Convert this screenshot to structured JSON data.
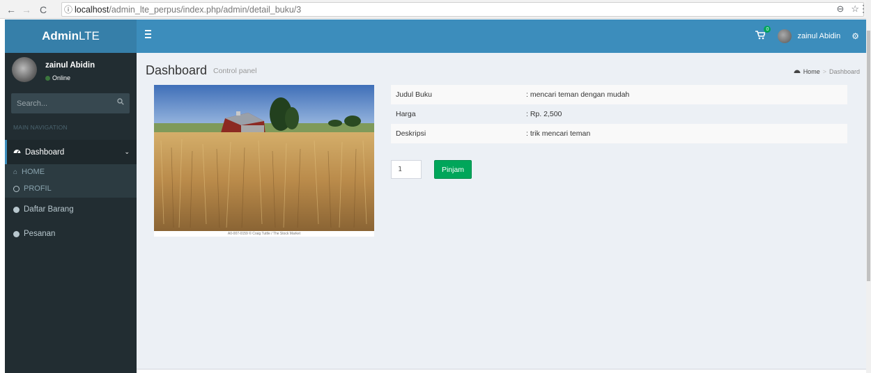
{
  "browser": {
    "url_host": "localhost",
    "url_path": "/admin_lte_perpus/index.php/admin/detail_buku/3"
  },
  "header": {
    "logo_bold": "Admin",
    "logo_rest": "LTE",
    "cart_badge": "0",
    "user_name": "zainul Abidin"
  },
  "sidebar": {
    "user_name": "zainul Abidin",
    "status": "Online",
    "search_placeholder": "Search...",
    "nav_header": "MAIN NAVIGATION",
    "items": [
      {
        "label": "Dashboard",
        "icon": "dashboard-icon"
      },
      {
        "label": "HOME",
        "icon": "home-icon"
      },
      {
        "label": "PROFIL",
        "icon": "circle-icon"
      },
      {
        "label": "Daftar Barang",
        "icon": "circle-icon"
      },
      {
        "label": "Pesanan",
        "icon": "circle-icon"
      }
    ]
  },
  "page": {
    "title": "Dashboard",
    "subtitle": "Control panel",
    "breadcrumb_home": "Home",
    "breadcrumb_current": "Dashboard",
    "photo_caption": "A0-007-0159 © Craig Tuttle / The Stock Market"
  },
  "book": {
    "rows": [
      {
        "label": "Judul Buku",
        "value": ": mencari teman dengan mudah"
      },
      {
        "label": "Harga",
        "value": ": Rp. 2,500"
      },
      {
        "label": "Deskripsi",
        "value": ": trik mencari teman"
      }
    ],
    "quantity": "1",
    "borrow_label": "Pinjam"
  },
  "colors": {
    "navbar": "#3c8dbc",
    "logo_bg": "#367fa9",
    "sidebar": "#222d32",
    "button": "#00a65a"
  }
}
